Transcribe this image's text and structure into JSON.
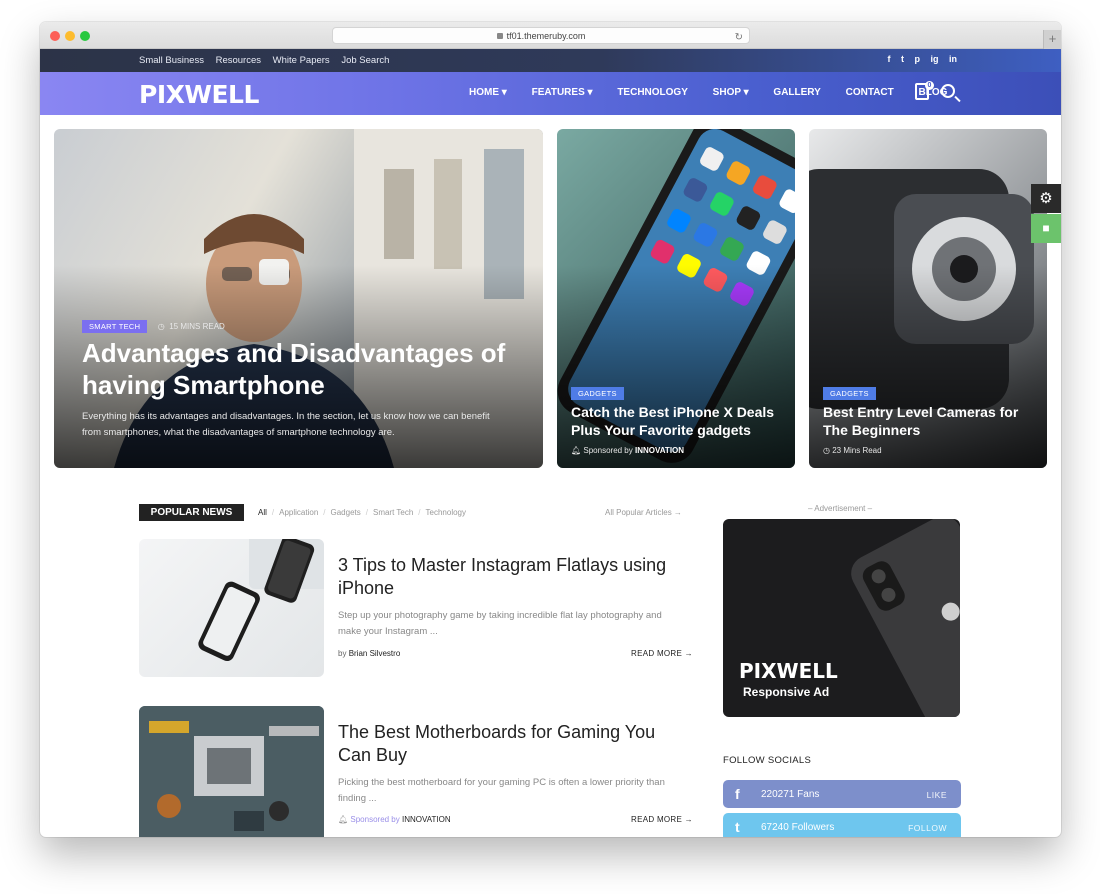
{
  "browser": {
    "url": "tf01.themeruby.com"
  },
  "topbar": {
    "links": [
      "Small Business",
      "Resources",
      "White Papers",
      "Job Search"
    ],
    "socials": [
      "f",
      "t",
      "p",
      "ig",
      "in"
    ]
  },
  "nav": {
    "logo": "PIXWELL",
    "items": [
      "HOME ▾",
      "FEATURES ▾",
      "TECHNOLOGY",
      "SHOP ▾",
      "GALLERY",
      "CONTACT",
      "BLOG"
    ],
    "cart_count": "0"
  },
  "hero": {
    "main": {
      "tag": "SMART TECH",
      "read_time": "15 MINS READ",
      "title": "Advantages and Disadvantages of having Smartphone",
      "desc": "Everything has its advantages and disadvantages. In the section, let us know how we can benefit from smartphones, what the disadvantages of smartphone technology are."
    },
    "second": {
      "tag": "GADGETS",
      "title": "Catch the Best iPhone X Deals Plus Your Favorite gadgets",
      "meta_prefix": "Sponsored by",
      "meta_sponsor": "INNOVATION"
    },
    "third": {
      "tag": "GADGETS",
      "title": "Best Entry Level Cameras for The Beginners",
      "read_time": "23 Mins Read"
    }
  },
  "popular": {
    "label": "POPULAR NEWS",
    "filters": [
      "All",
      "Application",
      "Gadgets",
      "Smart Tech",
      "Technology"
    ],
    "all_link": "All Popular Articles →",
    "articles": [
      {
        "title": "3 Tips to Master Instagram Flatlays using iPhone",
        "excerpt": "Step up your photography game by taking incredible flat lay photography and make your Instagram ...",
        "by": "by",
        "author": "Brian Silvestro",
        "read_more": "READ MORE →"
      },
      {
        "title": "The Best Motherboards for Gaming You Can Buy",
        "excerpt": "Picking the best motherboard for your gaming PC is often a lower priority than finding ...",
        "sponsored": "Sponsored by",
        "sponsor": "INNOVATION",
        "read_more": "READ MORE →"
      }
    ]
  },
  "sidebar": {
    "ad_label": "– Advertisement –",
    "ad_logo": "PIXWELL",
    "ad_text": "Responsive Ad",
    "follow_title": "FOLLOW SOCIALS",
    "socials": [
      {
        "icon": "f",
        "count": "220271 Fans",
        "action": "LIKE",
        "color": "#7d8fcb"
      },
      {
        "icon": "t",
        "count": "67240 Followers",
        "action": "FOLLOW",
        "color": "#6ec6ee"
      }
    ]
  },
  "colors": {
    "nav_start": "#8a86f2",
    "nav_end": "#3c4fb8",
    "tag_purple": "#7b6ff0",
    "tag_blue": "#4f7ce6"
  }
}
